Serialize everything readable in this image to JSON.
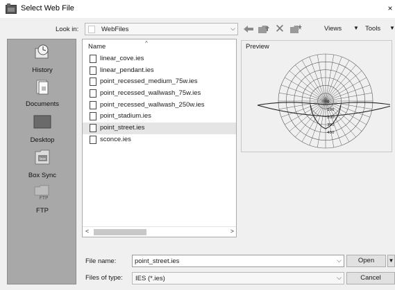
{
  "window": {
    "title": "Select Web File",
    "close_glyph": "×"
  },
  "toolbar": {
    "lookin_label": "Look in:",
    "current_folder": "WebFiles",
    "dropdown_glyph": "⌵",
    "views_label": "Views",
    "tools_label": "Tools",
    "caret_glyph": "▼",
    "icons": [
      "back-arrow-icon",
      "up-folder-icon",
      "delete-icon",
      "new-folder-icon"
    ]
  },
  "places": [
    {
      "label": "History",
      "icon": "history-icon"
    },
    {
      "label": "Documents",
      "icon": "documents-icon"
    },
    {
      "label": "Desktop",
      "icon": "desktop-icon"
    },
    {
      "label": "Box Sync",
      "icon": "box-sync-icon"
    },
    {
      "label": "FTP",
      "icon": "ftp-icon"
    }
  ],
  "file_list": {
    "header": "Name",
    "sort_glyph": "^",
    "files": [
      {
        "name": "linear_cove.ies",
        "selected": false
      },
      {
        "name": "linear_pendant.ies",
        "selected": false
      },
      {
        "name": "point_recessed_medium_75w.ies",
        "selected": false
      },
      {
        "name": "point_recessed_wallwash_75w.ies",
        "selected": false
      },
      {
        "name": "point_recessed_wallwash_250w.ies",
        "selected": false
      },
      {
        "name": "point_stadium.ies",
        "selected": false
      },
      {
        "name": "point_street.ies",
        "selected": true
      },
      {
        "name": "sconce.ies",
        "selected": false
      }
    ],
    "scroll_left_glyph": "<",
    "scroll_right_glyph": ">"
  },
  "preview": {
    "label": "Preview",
    "ring_labels": [
      "0",
      "100",
      "200",
      "300",
      "400"
    ]
  },
  "form": {
    "file_name_label": "File name:",
    "file_name_value": "point_street.ies",
    "file_type_label": "Files of type:",
    "file_type_value": "IES (*.ies)",
    "open_label": "Open",
    "open_split_glyph": "▼",
    "cancel_label": "Cancel"
  },
  "colors": {
    "places_bg": "#a8a8a8",
    "selected_row": "#e5e5e5",
    "window_bg": "#f0f0f0"
  }
}
